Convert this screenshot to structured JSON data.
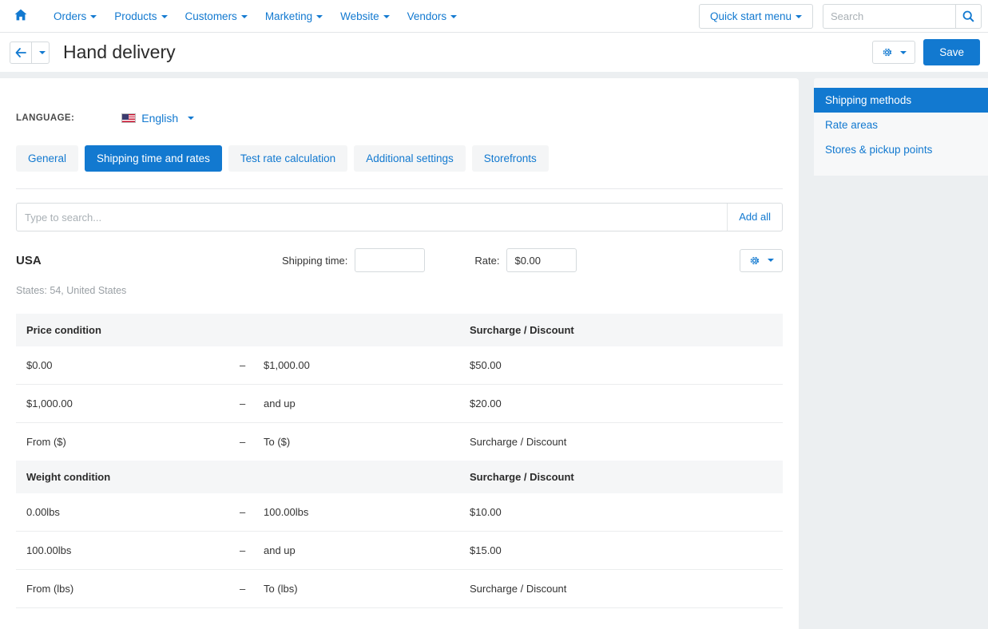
{
  "topnav": {
    "home_icon": "home-icon",
    "items": [
      {
        "label": "Orders"
      },
      {
        "label": "Products"
      },
      {
        "label": "Customers"
      },
      {
        "label": "Marketing"
      },
      {
        "label": "Website"
      },
      {
        "label": "Vendors"
      }
    ],
    "quick_start_label": "Quick start menu",
    "search": {
      "value": "",
      "placeholder": "Search",
      "icon": "search-icon"
    }
  },
  "titlebar": {
    "back_icon": "arrow-left-icon",
    "title": "Hand delivery",
    "gear_icon": "gear-icon",
    "save_label": "Save"
  },
  "content": {
    "language_label": "LANGUAGE:",
    "language_value": "English",
    "language_flag": "us-flag-icon",
    "tabs": [
      {
        "label": "General",
        "active": false
      },
      {
        "label": "Shipping time and rates",
        "active": true
      },
      {
        "label": "Test rate calculation",
        "active": false
      },
      {
        "label": "Additional settings",
        "active": false
      },
      {
        "label": "Storefronts",
        "active": false
      }
    ],
    "search_rates": {
      "value": "",
      "placeholder": "Type to search..."
    },
    "add_all_label": "Add all",
    "country": {
      "name": "USA",
      "shipping_time_label": "Shipping time:",
      "shipping_time_value": "",
      "rate_label": "Rate:",
      "rate_value": "$0.00",
      "gear_icon": "gear-icon",
      "states_line": "States: 54, United States"
    },
    "price_table": {
      "header_condition": "Price condition",
      "header_surcharge": "Surcharge / Discount",
      "dash": "–",
      "rows": [
        {
          "from": "$0.00",
          "to": "$1,000.00",
          "surcharge": "$50.00",
          "to_placeholder": false,
          "placeholder_row": false
        },
        {
          "from": "$1,000.00",
          "to": "and up",
          "surcharge": "$20.00",
          "to_placeholder": true,
          "placeholder_row": false
        },
        {
          "from": "From ($)",
          "to": "To ($)",
          "surcharge": "Surcharge / Discount",
          "to_placeholder": true,
          "placeholder_row": true
        }
      ]
    },
    "weight_table": {
      "header_condition": "Weight condition",
      "header_surcharge": "Surcharge / Discount",
      "dash": "–",
      "rows": [
        {
          "from": "0.00lbs",
          "to": "100.00lbs",
          "surcharge": "$10.00",
          "to_placeholder": false,
          "placeholder_row": false
        },
        {
          "from": "100.00lbs",
          "to": "and up",
          "surcharge": "$15.00",
          "to_placeholder": true,
          "placeholder_row": false
        },
        {
          "from": "From (lbs)",
          "to": "To (lbs)",
          "surcharge": "Surcharge / Discount",
          "to_placeholder": true,
          "placeholder_row": true
        }
      ]
    }
  },
  "right_panel": {
    "items": [
      {
        "label": "Shipping methods",
        "active": true
      },
      {
        "label": "Rate areas",
        "active": false
      },
      {
        "label": "Stores & pickup points",
        "active": false
      }
    ]
  },
  "colors": {
    "accent": "#1279d0",
    "page_bg": "#eceff1",
    "panel_bg": "#f7f8f9",
    "table_header_bg": "#f5f6f7"
  }
}
